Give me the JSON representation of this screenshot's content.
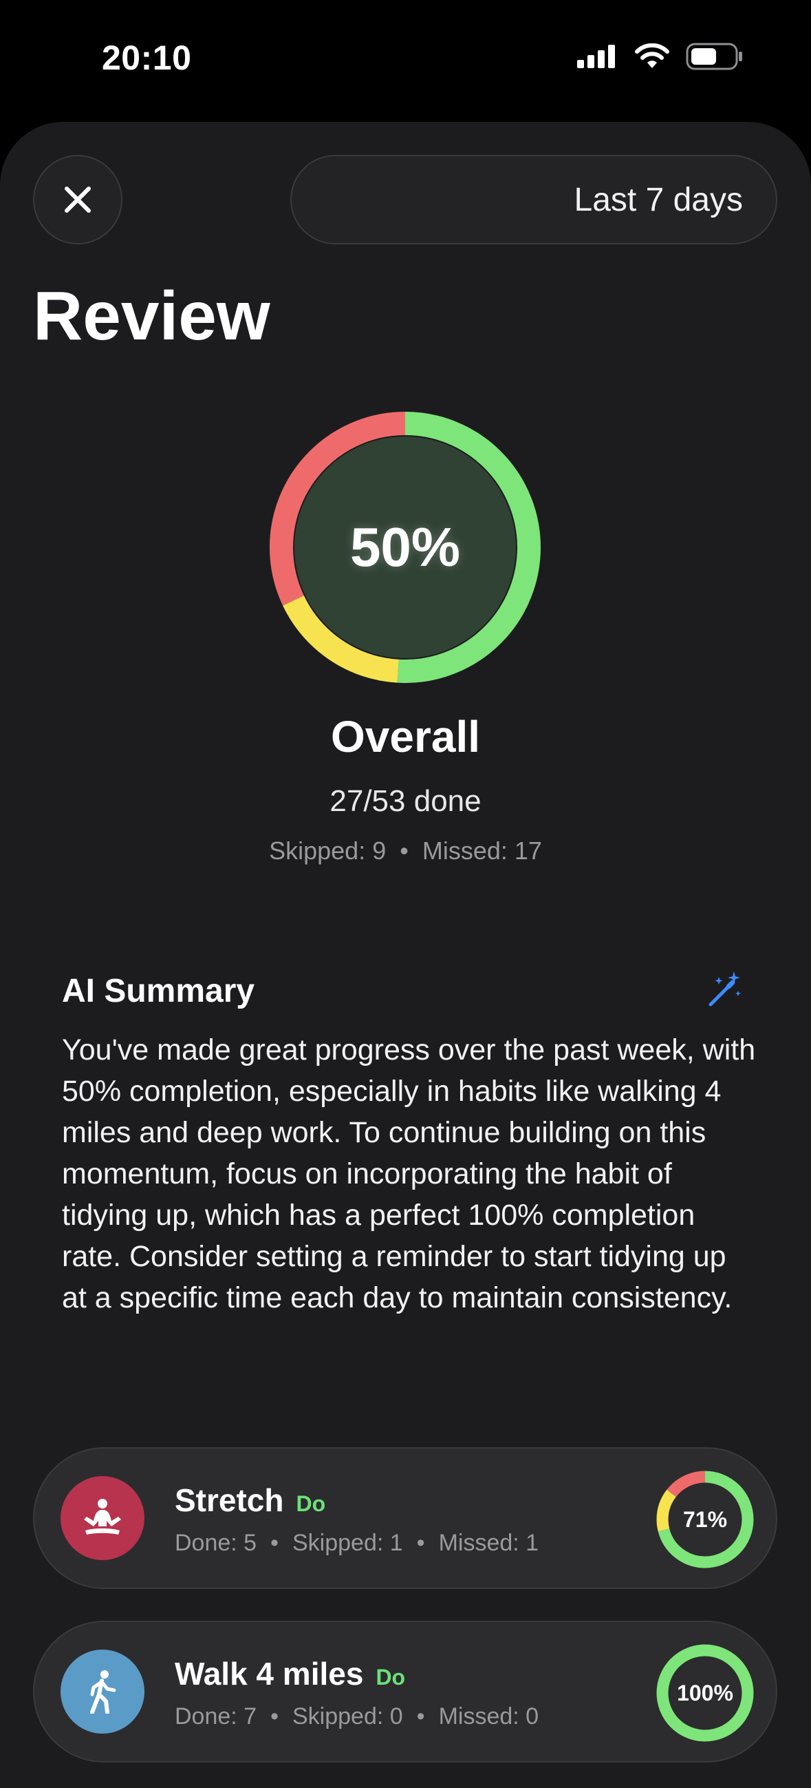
{
  "status_bar": {
    "time": "20:10"
  },
  "header": {
    "range_label": "Last 7 days"
  },
  "page": {
    "title": "Review"
  },
  "overall": {
    "percent_label": "50%",
    "title": "Overall",
    "done_label": "27/53 done",
    "skipped_label": "Skipped: 9",
    "missed_label": "Missed: 17",
    "done_fraction": 0.509,
    "skipped_fraction": 0.17,
    "missed_fraction": 0.321,
    "colors": {
      "done": "#7ee57a",
      "skipped": "#f7e34f",
      "missed": "#ef6b6b"
    }
  },
  "ai_summary": {
    "title": "AI Summary",
    "icon": "magic-wand-sparkles-icon",
    "text": "You've made great progress over the past week, with 50% completion, especially in habits like walking 4 miles and deep work. To continue building on this momentum, focus on incorporating the habit of tidying up, which has a perfect 100% completion rate. Consider setting a reminder to start tidying up at a specific time each day to maintain consistency."
  },
  "habits": [
    {
      "name": "Stretch",
      "tag": "Do",
      "icon": "meditation-icon",
      "icon_bg": "#b8334d",
      "done_label": "Done: 5",
      "skipped_label": "Skipped: 1",
      "missed_label": "Missed: 1",
      "percent_label": "71%",
      "done_fraction": 0.71,
      "skipped_fraction": 0.145,
      "missed_fraction": 0.145
    },
    {
      "name": "Walk 4 miles",
      "tag": "Do",
      "icon": "walking-icon",
      "icon_bg": "#5b9bc8",
      "done_label": "Done: 7",
      "skipped_label": "Skipped: 0",
      "missed_label": "Missed: 0",
      "percent_label": "100%",
      "done_fraction": 1.0,
      "skipped_fraction": 0,
      "missed_fraction": 0
    }
  ]
}
